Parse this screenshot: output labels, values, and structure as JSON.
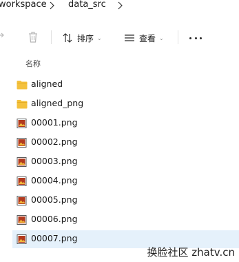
{
  "breadcrumb": {
    "items": [
      "workspace",
      "data_src"
    ]
  },
  "toolbar": {
    "sort_label": "排序",
    "view_label": "查看"
  },
  "columns": {
    "name_header": "名称"
  },
  "files": [
    {
      "name": "aligned",
      "type": "folder",
      "selected": false
    },
    {
      "name": "aligned_png",
      "type": "folder",
      "selected": false
    },
    {
      "name": "00001.png",
      "type": "png",
      "selected": false
    },
    {
      "name": "00002.png",
      "type": "png",
      "selected": false
    },
    {
      "name": "00003.png",
      "type": "png",
      "selected": false
    },
    {
      "name": "00004.png",
      "type": "png",
      "selected": false
    },
    {
      "name": "00005.png",
      "type": "png",
      "selected": false
    },
    {
      "name": "00006.png",
      "type": "png",
      "selected": false
    },
    {
      "name": "00007.png",
      "type": "png",
      "selected": true
    }
  ],
  "watermark": "换脸社区 zhatv.cn",
  "colors": {
    "folder": "#f4c13d",
    "selection": "#e5f1fb"
  }
}
